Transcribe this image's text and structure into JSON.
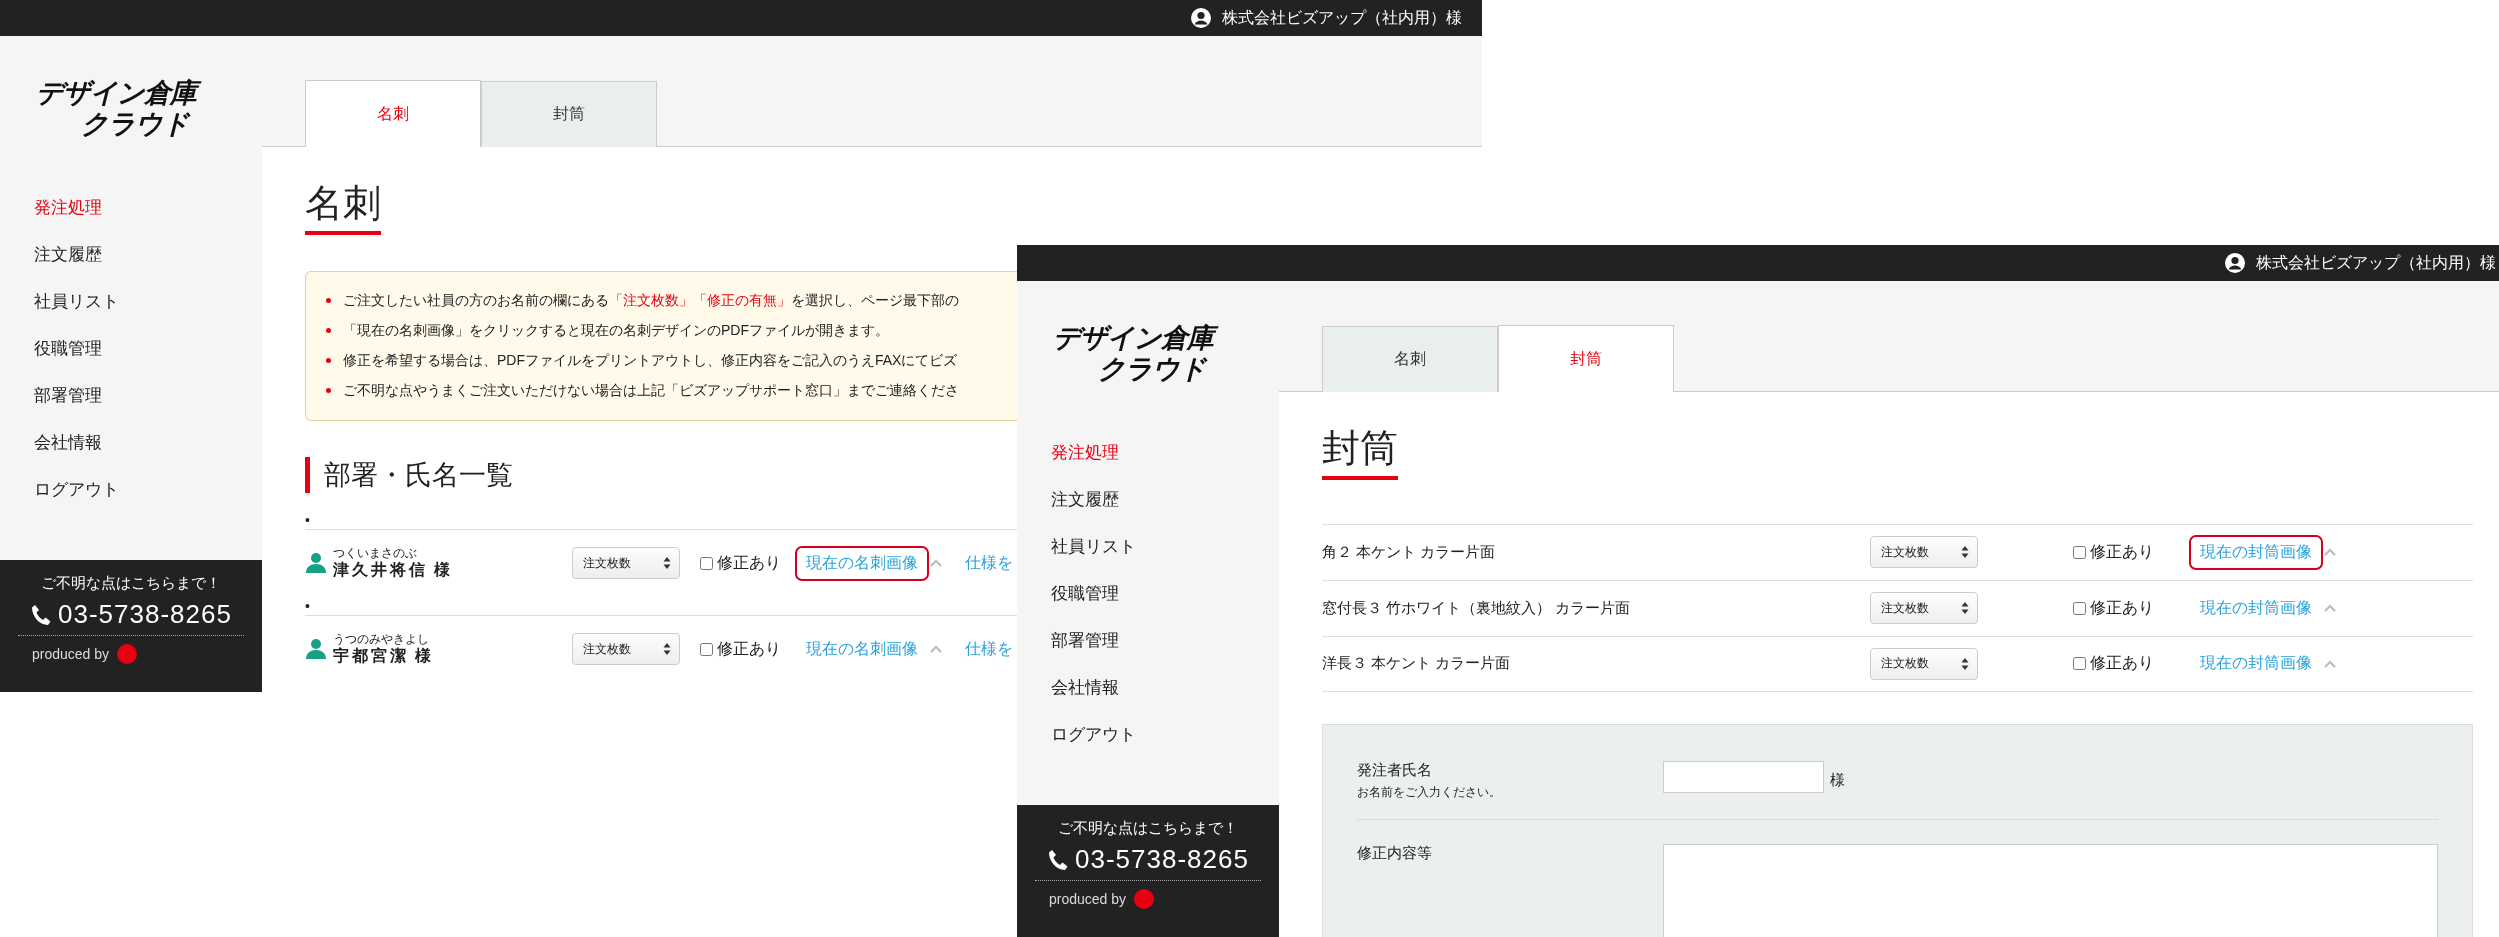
{
  "windows": [
    {
      "kind": "cards",
      "account": "株式会社ビズアップ（社内用）様",
      "logo": [
        "デザイン倉庫",
        "クラウド"
      ],
      "tabs": [
        {
          "label": "名刺",
          "selected": true
        },
        {
          "label": "封筒",
          "selected": false
        }
      ],
      "nav": [
        {
          "label": "発注処理",
          "selected": true
        },
        {
          "label": "注文履歴",
          "selected": false
        },
        {
          "label": "社員リスト",
          "selected": false
        },
        {
          "label": "役職管理",
          "selected": false
        },
        {
          "label": "部署管理",
          "selected": false
        },
        {
          "label": "会社情報",
          "selected": false
        },
        {
          "label": "ログアウト",
          "selected": false
        }
      ],
      "help": {
        "title": "ご不明な点はこちらまで！",
        "phone": "03-5738-8265",
        "credit": "produced by"
      },
      "page_title": "名刺",
      "notices": [
        {
          "parts": [
            {
              "text": "ご注文したい社員の方のお名前の欄にある",
              "emphasis": false
            },
            {
              "text": "「注文枚数」「修正の有無」",
              "emphasis": true
            },
            {
              "text": "を選択し、ページ最下部の",
              "emphasis": false
            }
          ]
        },
        {
          "parts": [
            {
              "text": "「現在の名刺画像」をクリックすると現在の名刺デザインのPDFファイルが開きます。",
              "emphasis": false
            }
          ]
        },
        {
          "parts": [
            {
              "text": "修正を希望する場合は、PDFファイルをプリントアウトし、修正内容をご記入のうえFAXにてビズ",
              "emphasis": false
            }
          ]
        },
        {
          "parts": [
            {
              "text": "ご不明な点やうまくご注文いただけない場合は上記「ビズアップサポート窓口」までご連絡くださ",
              "emphasis": false
            }
          ]
        }
      ],
      "section_title": "部署・氏名一覧",
      "rows": [
        {
          "bullet": "•",
          "furigana": "つくいまさのぶ",
          "name": "津久井将信",
          "honorific": "様",
          "quantity": "注文枚数",
          "revision_label": "修正あり",
          "revision_checked": false,
          "image_link": "現在の名刺画像",
          "highlighted": true,
          "spec_link": "仕様を"
        },
        {
          "bullet": "•",
          "furigana": "うつのみやきよし",
          "name": "宇都宮潔",
          "honorific": "様",
          "quantity": "注文枚数",
          "revision_label": "修正あり",
          "revision_checked": false,
          "image_link": "現在の名刺画像",
          "highlighted": false,
          "spec_link": "仕様を"
        }
      ]
    },
    {
      "kind": "envelopes",
      "account": "株式会社ビズアップ（社内用）様",
      "logo": [
        "デザイン倉庫",
        "クラウド"
      ],
      "tabs": [
        {
          "label": "名刺",
          "selected": false
        },
        {
          "label": "封筒",
          "selected": true
        }
      ],
      "nav": [
        {
          "label": "発注処理",
          "selected": true
        },
        {
          "label": "注文履歴",
          "selected": false
        },
        {
          "label": "社員リスト",
          "selected": false
        },
        {
          "label": "役職管理",
          "selected": false
        },
        {
          "label": "部署管理",
          "selected": false
        },
        {
          "label": "会社情報",
          "selected": false
        },
        {
          "label": "ログアウト",
          "selected": false
        }
      ],
      "help": {
        "title": "ご不明な点はこちらまで！",
        "phone": "03-5738-8265",
        "credit": "produced by"
      },
      "page_title": "封筒",
      "rows": [
        {
          "name": "角２ 本ケント カラー片面",
          "quantity": "注文枚数",
          "revision_label": "修正あり",
          "revision_checked": false,
          "image_link": "現在の封筒画像",
          "highlighted": true
        },
        {
          "name": "窓付長３ 竹ホワイト（裏地紋入） カラー片面",
          "quantity": "注文枚数",
          "revision_label": "修正あり",
          "revision_checked": false,
          "image_link": "現在の封筒画像",
          "highlighted": false
        },
        {
          "name": "洋長３ 本ケント カラー片面",
          "quantity": "注文枚数",
          "revision_label": "修正あり",
          "revision_checked": false,
          "image_link": "現在の封筒画像",
          "highlighted": false
        }
      ],
      "form": [
        {
          "kind": "input",
          "label": "発注者氏名",
          "hint": "お名前をご入力ください。",
          "suffix": "様"
        },
        {
          "kind": "textarea",
          "label": "修正内容等"
        }
      ]
    }
  ]
}
